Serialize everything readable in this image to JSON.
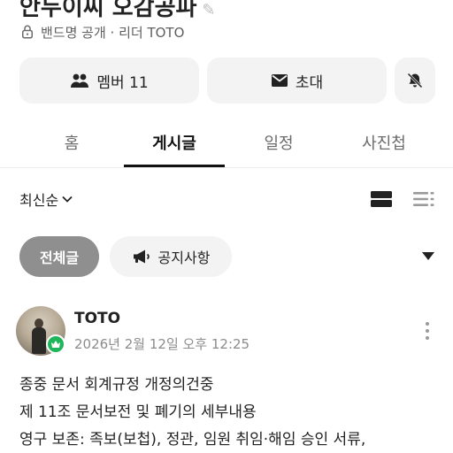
{
  "header": {
    "band_name": "안두이씨 오감공파",
    "meta": "밴드명 공개 · 리더 TOTO"
  },
  "actions": {
    "member_label": "멤버 11",
    "invite_label": "초대"
  },
  "tabs": [
    {
      "label": "홈"
    },
    {
      "label": "게시글"
    },
    {
      "label": "일정"
    },
    {
      "label": "사진첩"
    }
  ],
  "sort": {
    "label": "최신순"
  },
  "filters": {
    "all_label": "전체글",
    "notice_label": "공지사항"
  },
  "post": {
    "author": "TOTO",
    "date": "2026년 2월 12일 오후 12:25",
    "lines": [
      "종중 문서 회계규정 개정의건중",
      "제 11조 문서보전 및 폐기의 세부내용",
      "영구 보존: 족보(보첩), 정관, 임원 취임·해임 승인 서류,"
    ]
  }
}
